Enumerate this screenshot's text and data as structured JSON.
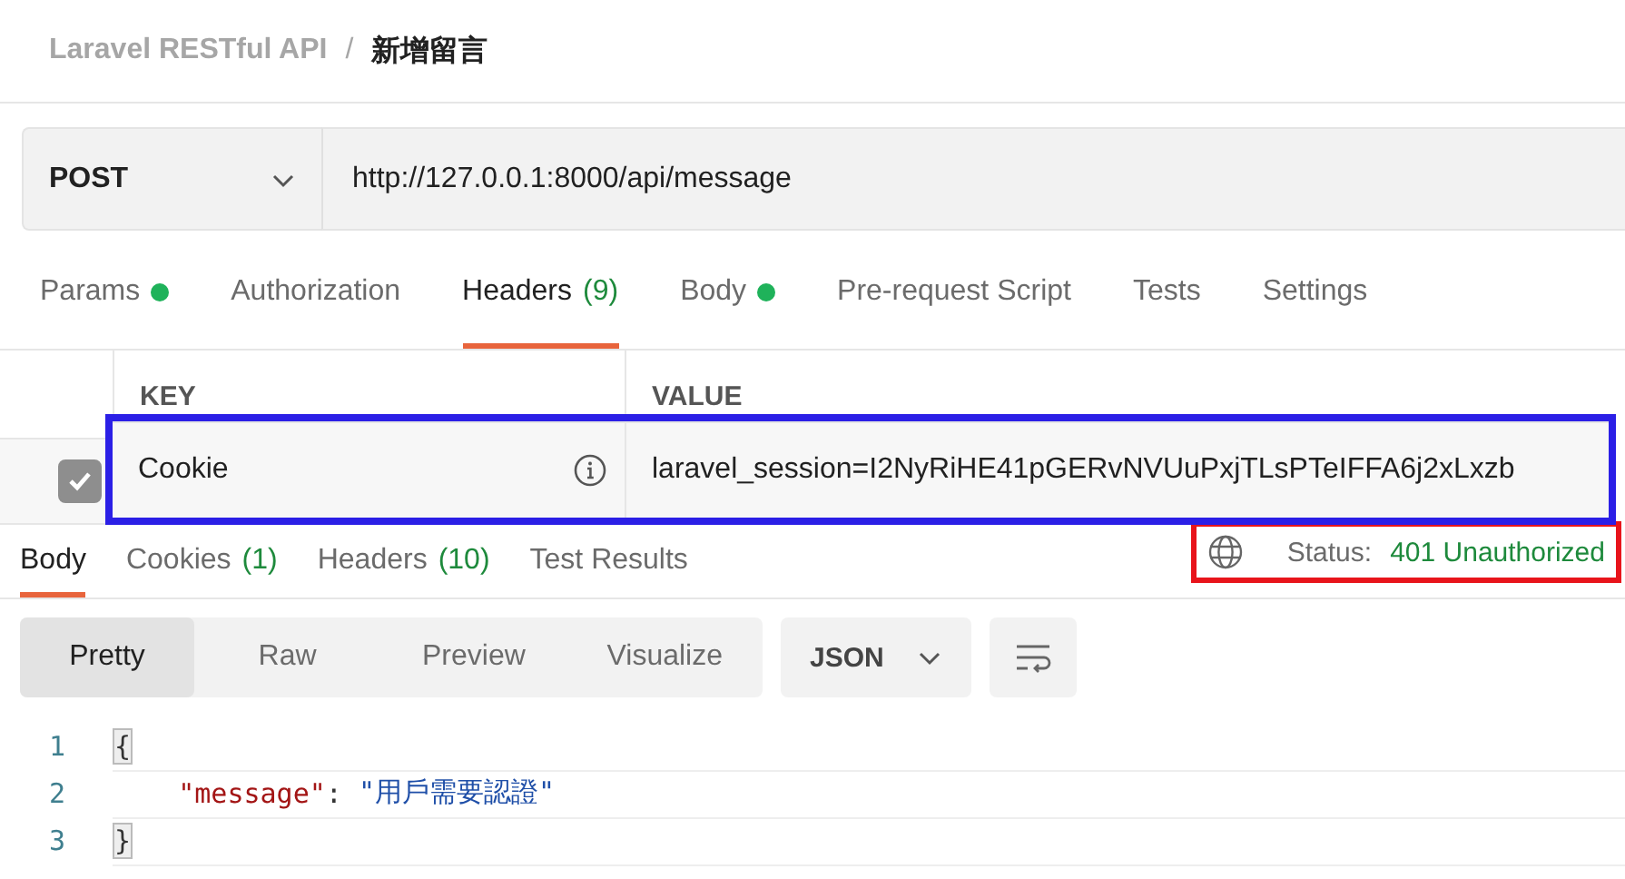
{
  "breadcrumb": {
    "collection": "Laravel RESTful API",
    "separator": "/",
    "request": "新增留言"
  },
  "request": {
    "method": "POST",
    "url": "http://127.0.0.1:8000/api/message"
  },
  "request_tabs": [
    {
      "label": "Params",
      "dot": true,
      "selected": false
    },
    {
      "label": "Authorization",
      "dot": false,
      "selected": false
    },
    {
      "label": "Headers",
      "count": "(9)",
      "dot": false,
      "selected": true
    },
    {
      "label": "Body",
      "dot": true,
      "selected": false
    },
    {
      "label": "Pre-request Script",
      "dot": false,
      "selected": false
    },
    {
      "label": "Tests",
      "dot": false,
      "selected": false
    },
    {
      "label": "Settings",
      "dot": false,
      "selected": false
    }
  ],
  "headers_table": {
    "columns": [
      "KEY",
      "VALUE"
    ],
    "rows": [
      {
        "checked": true,
        "key": "Cookie",
        "value": "laravel_session=I2NyRiHE41pGERvNVUuPxjTLsPTeIFFA6j2xLxzb",
        "highlighted": true
      }
    ]
  },
  "response": {
    "tabs": [
      {
        "label": "Body",
        "selected": true
      },
      {
        "label": "Cookies",
        "count": "(1)",
        "selected": false
      },
      {
        "label": "Headers",
        "count": "(10)",
        "selected": false
      },
      {
        "label": "Test Results",
        "selected": false
      }
    ],
    "status": {
      "label": "Status:",
      "value": "401 Unauthorized",
      "highlighted": true
    },
    "formats": [
      {
        "label": "Pretty",
        "selected": true
      },
      {
        "label": "Raw",
        "selected": false
      },
      {
        "label": "Preview",
        "selected": false
      },
      {
        "label": "Visualize",
        "selected": false
      }
    ],
    "language": "JSON",
    "code": [
      {
        "number": "1",
        "tokens": [
          {
            "kind": "brace",
            "text": "{"
          }
        ]
      },
      {
        "number": "2",
        "tokens": [
          {
            "kind": "key",
            "text": "    \"message\""
          },
          {
            "kind": "punct",
            "text": ": "
          },
          {
            "kind": "string",
            "text": "\"用戶需要認證\""
          }
        ]
      },
      {
        "number": "3",
        "tokens": [
          {
            "kind": "brace",
            "text": "}"
          }
        ]
      }
    ]
  }
}
